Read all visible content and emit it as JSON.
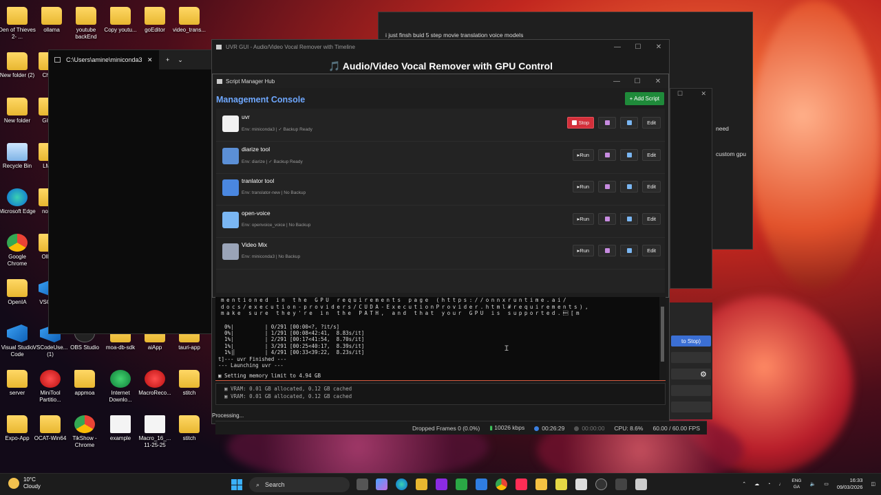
{
  "desktop": {
    "icons": [
      {
        "label": "Den of Thieves 2- ...",
        "kind": "folder"
      },
      {
        "label": "ollama",
        "kind": "folder"
      },
      {
        "label": "youtube backEnd",
        "kind": "folder"
      },
      {
        "label": "Copy youtu...",
        "kind": "folder"
      },
      {
        "label": "goEditor",
        "kind": "folder"
      },
      {
        "label": "video_trans...",
        "kind": "folder"
      },
      {
        "label": "New folder (2)",
        "kind": "folder"
      },
      {
        "label": "Chr...",
        "kind": "folder"
      },
      {
        "label": "New folder",
        "kind": "folder"
      },
      {
        "label": "Git-...",
        "kind": "folder"
      },
      {
        "label": "Recycle Bin",
        "kind": "bin"
      },
      {
        "label": "LM...",
        "kind": "folder"
      },
      {
        "label": "Microsoft Edge",
        "kind": "edge"
      },
      {
        "label": "nod...",
        "kind": "folder"
      },
      {
        "label": "Google Chrome",
        "kind": "chrome"
      },
      {
        "label": "Olla...",
        "kind": "folder"
      },
      {
        "label": "OpenIA",
        "kind": "folder"
      },
      {
        "label": "VSCo...",
        "kind": "vs"
      },
      {
        "label": "Visual Studio Code",
        "kind": "vs"
      },
      {
        "label": "VSCodeUse... (1)",
        "kind": "vs"
      },
      {
        "label": "OBS Studio",
        "kind": "black"
      },
      {
        "label": "moa-db-sdk",
        "kind": "folder"
      },
      {
        "label": "aiApp",
        "kind": "folder"
      },
      {
        "label": "tauri-app",
        "kind": "folder"
      },
      {
        "label": "server",
        "kind": "folder"
      },
      {
        "label": "MiniTool Partitio...",
        "kind": "red"
      },
      {
        "label": "appmoa",
        "kind": "folder"
      },
      {
        "label": "Internet Downlo...",
        "kind": "globe"
      },
      {
        "label": "MacroReco...",
        "kind": "red"
      },
      {
        "label": "stitch",
        "kind": "folder"
      },
      {
        "label": "Expo-App",
        "kind": "folder"
      },
      {
        "label": "OCAT-Win64",
        "kind": "folder"
      },
      {
        "label": "TikShow - Chrome",
        "kind": "chrome"
      },
      {
        "label": "example",
        "kind": "doc"
      },
      {
        "label": "Macro_16_... 11-25-25",
        "kind": "doc"
      },
      {
        "label": "stitch",
        "kind": "folder"
      }
    ]
  },
  "terminal": {
    "tab_title": "C:\\Users\\amine\\miniconda3\\",
    "close": "✕",
    "new_tab": "+",
    "dropdown": "⌄"
  },
  "uvr_window": {
    "title": "UVR GUI - Audio/Video Vocal Remover with Timeline",
    "heading": "🎵 Audio/Video Vocal Remover with GPU Control",
    "min": "—",
    "max": "☐",
    "close": "✕"
  },
  "chat": {
    "message": "i just finsh buid 5 step movie translation voice models",
    "side_text_1": "need",
    "side_text_2": "custom gpu"
  },
  "obs_right": {
    "stop_label": "to Stop)",
    "gear": "⚙"
  },
  "script_manager": {
    "title": "Script Manager Hub",
    "heading": "Management Console",
    "add_label": "+ Add Script",
    "min": "—",
    "max": "☐",
    "close": "✕",
    "scripts": [
      {
        "name": "uvr",
        "env": "Env: miniconda3 | ✓ Backup Ready",
        "action": "Stop",
        "running": true,
        "edit": "Edit",
        "icon_color": "#f2f2f2"
      },
      {
        "name": "diarize tool",
        "env": "Env: diarize | ✓ Backup Ready",
        "action": "▸Run",
        "running": false,
        "edit": "Edit",
        "icon_color": "#5b8fd6"
      },
      {
        "name": "tranlator tool",
        "env": "Env: translator-new | No Backup",
        "action": "▸Run",
        "running": false,
        "edit": "Edit",
        "icon_color": "#4a87e0"
      },
      {
        "name": "open-voice",
        "env": "Env: openvoice_voice | No Backup",
        "action": "▸Run",
        "running": false,
        "edit": "Edit",
        "icon_color": "#7ab6f2"
      },
      {
        "name": "Video Mix",
        "env": "Env: miniconda3 | No Backup",
        "action": "▸Run",
        "running": false,
        "edit": "Edit",
        "icon_color": "#9aa4b8"
      }
    ]
  },
  "console": {
    "wrapped_line_1": "mentioned in the GPU requirements page (https://onnxruntime.ai/",
    "wrapped_line_2": "docs/execution-providers/CUDA-ExecutionProvider.html#requirements),",
    "wrapped_line_3": "make sure they're in the PATH, and that your GPU is supported.\u001b[m",
    "progress_lines": [
      "  0%|          | 0/291 [00:00<?, ?it/s]",
      "  0%|          | 1/291 [00:08<42:41,  8.83s/it]",
      "  1%|          | 2/291 [00:17<41:54,  8.70s/it]",
      "  1%|          | 3/291 [00:25<40:17,  8.39s/it]",
      "  1%|▏         | 4/291 [00:33<39:22,  8.23s/it]"
    ],
    "finished": "t]--- uvr Finished ---",
    "launching": "--- Launching uvr ---",
    "memory": "▣ Setting memory limit to 4.94 GB"
  },
  "vram": {
    "line_1": "▣ VRAM: 0.01 GB allocated, 0.12 GB cached",
    "line_2": "▣ VRAM: 0.01 GB allocated, 0.12 GB cached"
  },
  "processing": "Processing...",
  "obs_status": {
    "dropped": "Dropped Frames 0 (0.0%)",
    "kbps": "10026 kbps",
    "rec_time": "00:26:29",
    "stream_time": "00:00:00",
    "cpu": "CPU: 8.6%",
    "fps": "60.00 / 60.00 FPS"
  },
  "taskbar": {
    "temp": "10°C",
    "condition": "Cloudy",
    "search_label": "Search",
    "lang_top": "ENG",
    "lang_bottom": "GA",
    "time": "16:33",
    "date": "09/03/2026",
    "chevron": "⌃"
  },
  "colors": {
    "accent_blue": "#6fa8ff",
    "add_green": "#1f8a3a",
    "stop_red": "#d32f3a"
  }
}
